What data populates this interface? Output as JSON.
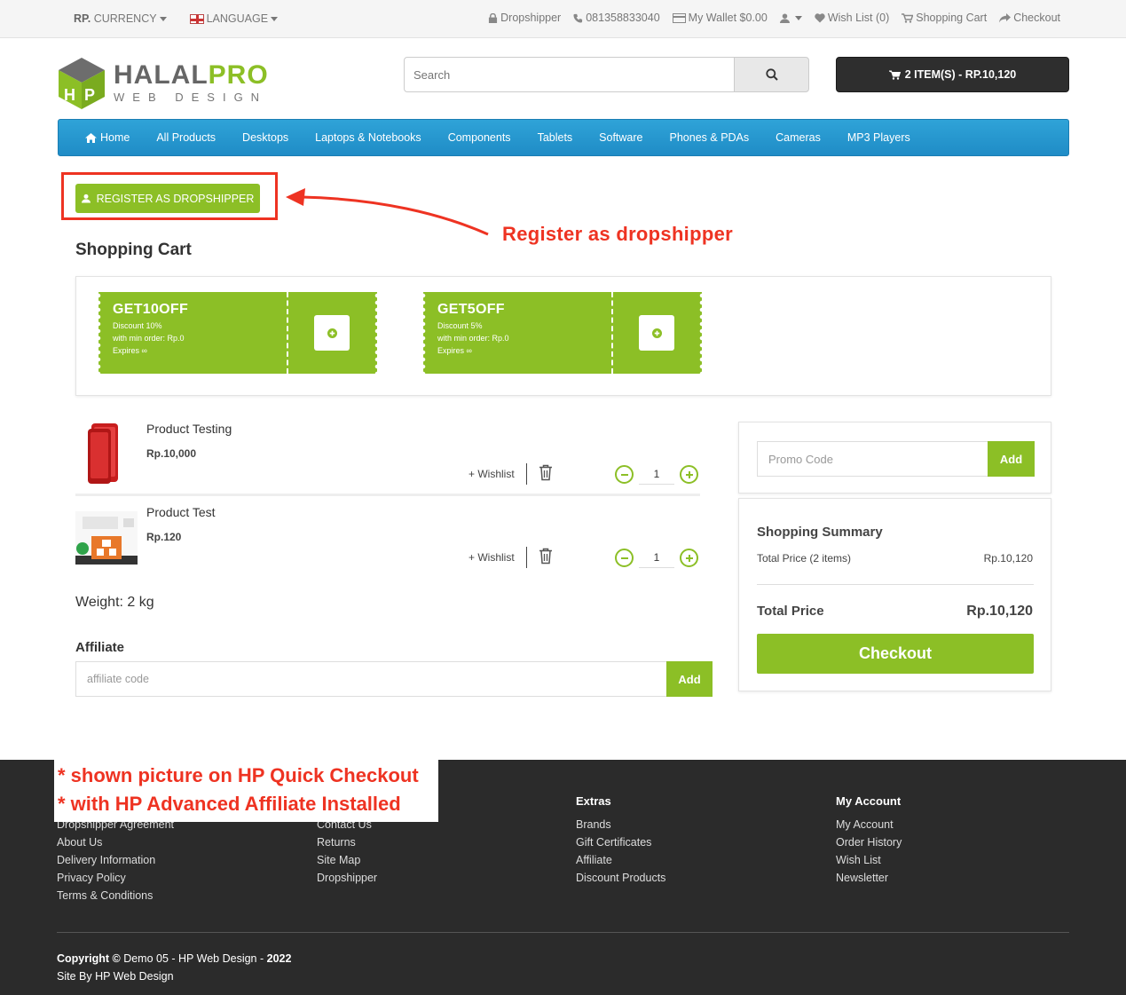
{
  "topbar": {
    "currency": "RP.",
    "currency_label": "CURRENCY",
    "language_label": "LANGUAGE",
    "dropshipper": "Dropshipper",
    "phone": "081358833040",
    "wallet": "My Wallet $0.00",
    "wishlist": "Wish List (0)",
    "shopping_cart": "Shopping Cart",
    "checkout": "Checkout"
  },
  "logo": {
    "part1": "HALAL",
    "part2": "PRO",
    "sub": "WEB DESIGN"
  },
  "search": {
    "placeholder": "Search"
  },
  "cart": {
    "label": "2 ITEM(S) - RP.10,120"
  },
  "nav": [
    "Home",
    "All Products",
    "Desktops",
    "Laptops & Notebooks",
    "Components",
    "Tablets",
    "Software",
    "Phones & PDAs",
    "Cameras",
    "MP3 Players"
  ],
  "register_btn": "REGISTER AS DROPSHIPPER",
  "annotation": "Register as dropshipper",
  "page_title": "Shopping Cart",
  "coupons": [
    {
      "code": "GET10OFF",
      "discount": "Discount 10%",
      "min": "with min order: Rp.0",
      "expires": "Expires ∞"
    },
    {
      "code": "GET5OFF",
      "discount": "Discount 5%",
      "min": "with min order: Rp.0",
      "expires": "Expires ∞"
    }
  ],
  "items": [
    {
      "name": "Product Testing",
      "price": "Rp.10,000",
      "qty": "1",
      "wishlist": "+ Wishlist"
    },
    {
      "name": "Product Test",
      "price": "Rp.120",
      "qty": "1",
      "wishlist": "+ Wishlist"
    }
  ],
  "weight": "Weight: 2 kg",
  "affiliate": {
    "heading": "Affiliate",
    "placeholder": "affiliate code",
    "add": "Add"
  },
  "promo": {
    "placeholder": "Promo Code",
    "add": "Add"
  },
  "summary": {
    "heading": "Shopping Summary",
    "total_label": "Total Price (2 items)",
    "total_value": "Rp.10,120",
    "grand_label": "Total Price",
    "grand_value": "Rp.10,120",
    "checkout": "Checkout"
  },
  "notes": [
    "* shown picture on HP Quick Checkout",
    "* with HP Advanced Affiliate Installed"
  ],
  "footer": {
    "col1": {
      "links": [
        "Dropshipper Agreement",
        "About Us",
        "Delivery Information",
        "Privacy Policy",
        "Terms & Conditions"
      ]
    },
    "col2": {
      "links": [
        "Contact Us",
        "Returns",
        "Site Map",
        "Dropshipper"
      ]
    },
    "col3": {
      "heading": "Extras",
      "links": [
        "Brands",
        "Gift Certificates",
        "Affiliate",
        "Discount Products"
      ]
    },
    "col4": {
      "heading": "My Account",
      "links": [
        "My Account",
        "Order History",
        "Wish List",
        "Newsletter"
      ]
    },
    "copyright_prefix": "Copyright ©",
    "copyright_name": "Demo 05 - HP Web Design",
    "copyright_sep": " - ",
    "copyright_year": "2022",
    "site_by": "Site By HP Web Design"
  },
  "colors": {
    "accent": "#8cbf26",
    "nav": "#1f8cc6",
    "annotation": "#ee3322",
    "footer": "#2b2b2b"
  }
}
